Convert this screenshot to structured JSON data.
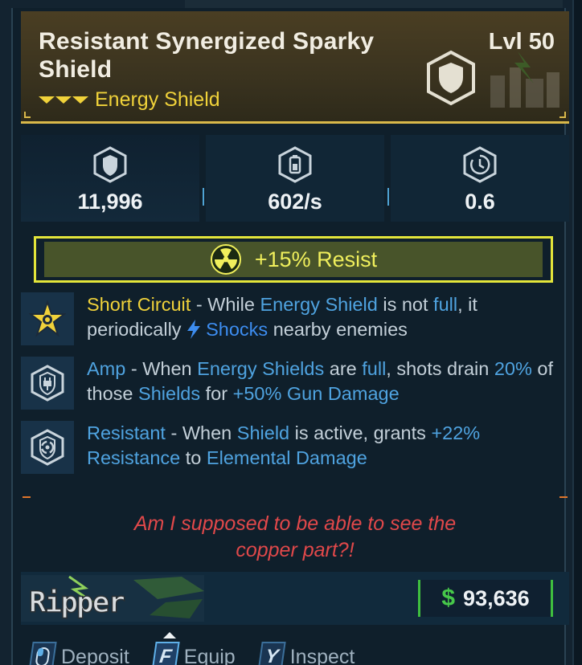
{
  "header": {
    "title": "Resistant Synergized Sparky Shield",
    "level": "Lvl 50",
    "item_type": "Energy Shield",
    "rarity_color": "#f0d23a"
  },
  "stats": [
    {
      "icon": "shield-capacity-icon",
      "value": "11,996"
    },
    {
      "icon": "recharge-rate-icon",
      "value": "602/s"
    },
    {
      "icon": "recharge-delay-icon",
      "value": "0.6"
    }
  ],
  "element": {
    "icon": "radiation-icon",
    "text": "+15% Resist",
    "color": "#f0ef5c"
  },
  "perks": [
    {
      "icon": "star-burst-icon",
      "name": "Short Circuit",
      "sep": " - While ",
      "kw1": "Energy Shield",
      "t1": " is not ",
      "kw2": "full",
      "t2": ", it periodically ",
      "shock_icon": "lightning-bolt-icon",
      "kw3": "Shocks",
      "t3": " nearby enemies"
    },
    {
      "icon": "shield-plug-icon",
      "name": "Amp",
      "sep": " - When ",
      "kw1": "Energy Shields",
      "t1": " are ",
      "kw2": "full",
      "t2": ", shots drain ",
      "kw3": "20%",
      "t3": " of those ",
      "kw4": "Shields",
      "t4": " for ",
      "kw5": "+50% Gun Damage"
    },
    {
      "icon": "shield-swirl-icon",
      "name": "Resistant",
      "sep": " - When ",
      "kw1": "Shield",
      "t1": " is active, grants ",
      "kw2": "+22%",
      "kw3": "Resistance",
      "t3": " to ",
      "kw4": "Elemental Damage"
    }
  ],
  "flavor_text_1": "Am I supposed to be able to see the",
  "flavor_text_2": "copper part?!",
  "footer": {
    "manufacturer": "Ripper",
    "price_symbol": "$",
    "price": "93,636"
  },
  "actions": [
    {
      "key": "",
      "label": "Deposit",
      "icon": "mouse-icon"
    },
    {
      "key": "F",
      "label": "Equip"
    },
    {
      "key": "Y",
      "label": "Inspect"
    }
  ]
}
